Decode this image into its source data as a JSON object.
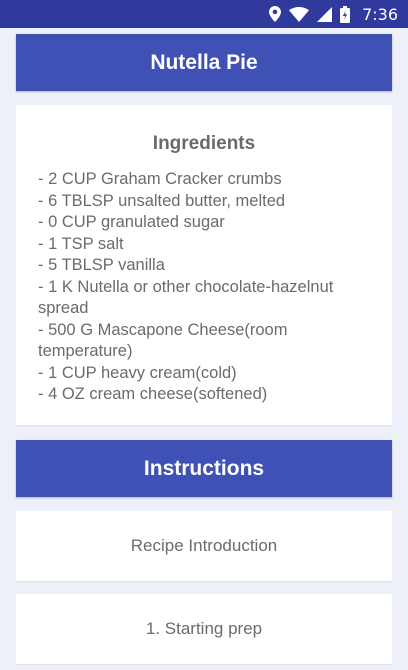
{
  "status_bar": {
    "time": "7:36",
    "icons": [
      "location-icon",
      "wifi-icon",
      "signal-icon",
      "battery-icon"
    ]
  },
  "recipe": {
    "title": "Nutella Pie"
  },
  "ingredients": {
    "heading": "Ingredients",
    "items": [
      "- 2 CUP Graham Cracker crumbs",
      "- 6 TBLSP unsalted butter, melted",
      "- 0 CUP granulated sugar",
      "- 1 TSP salt",
      "- 5 TBLSP vanilla",
      "- 1 K Nutella or other chocolate-hazelnut spread",
      "- 500 G Mascapone Cheese(room temperature)",
      "- 1 CUP heavy cream(cold)",
      "- 4 OZ cream cheese(softened)"
    ]
  },
  "instructions": {
    "heading": "Instructions",
    "steps": [
      "Recipe Introduction",
      "1. Starting prep"
    ]
  },
  "colors": {
    "status_bar": "#2f3a9c",
    "banner": "#3f51b5",
    "background": "#eef0f9",
    "card": "#ffffff",
    "text": "#6b6b6b"
  }
}
